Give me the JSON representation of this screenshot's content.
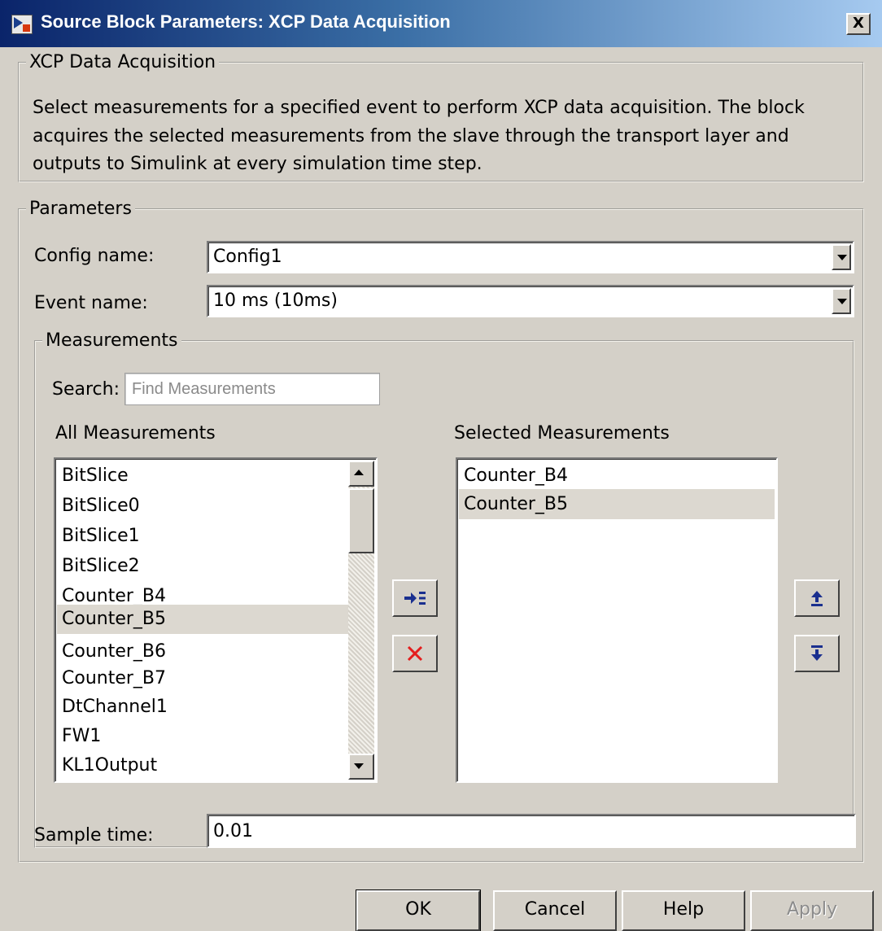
{
  "window": {
    "title": "Source Block Parameters: XCP Data Acquisition",
    "close_glyph": "X"
  },
  "description_group": {
    "title": "XCP Data Acquisition",
    "text": "Select measurements for a specified event to perform XCP data acquisition. The block acquires the selected measurements from the slave through the transport layer and outputs to Simulink at every simulation time step."
  },
  "parameters": {
    "title": "Parameters",
    "config_name": {
      "label": "Config name:",
      "value": "Config1"
    },
    "event_name": {
      "label": "Event name:",
      "value": "10 ms (10ms)"
    },
    "sample_time": {
      "label": "Sample time:",
      "value": "0.01"
    }
  },
  "measurements": {
    "title": "Measurements",
    "search_label": "Search:",
    "search_placeholder": "Find Measurements",
    "all_label": "All Measurements",
    "selected_label": "Selected Measurements",
    "all_items": [
      "BitSlice",
      "BitSlice0",
      "BitSlice1",
      "BitSlice2",
      "Counter_B4",
      "Counter_B5",
      "Counter_B6",
      "Counter_B7",
      "DtChannel1",
      "FW1",
      "KL1Output"
    ],
    "all_selected_item": "Counter_B5",
    "selected_items": [
      "Counter_B4",
      "Counter_B5"
    ],
    "selected_highlighted_item": "Counter_B5"
  },
  "icons": {
    "add": "add-measurement-icon",
    "remove": "remove-measurement-icon",
    "move_up": "move-up-icon",
    "move_down": "move-down-icon"
  },
  "colors": {
    "title_gradient_start": "#0a246a",
    "title_gradient_end": "#a6caf0",
    "dialog_bg": "#d4d0c8",
    "selection_bg": "#dcd8d0",
    "icon_blue": "#1a2f8f",
    "remove_red": "#e41e1e"
  },
  "buttons": {
    "ok": "OK",
    "cancel": "Cancel",
    "help": "Help",
    "apply": "Apply"
  }
}
